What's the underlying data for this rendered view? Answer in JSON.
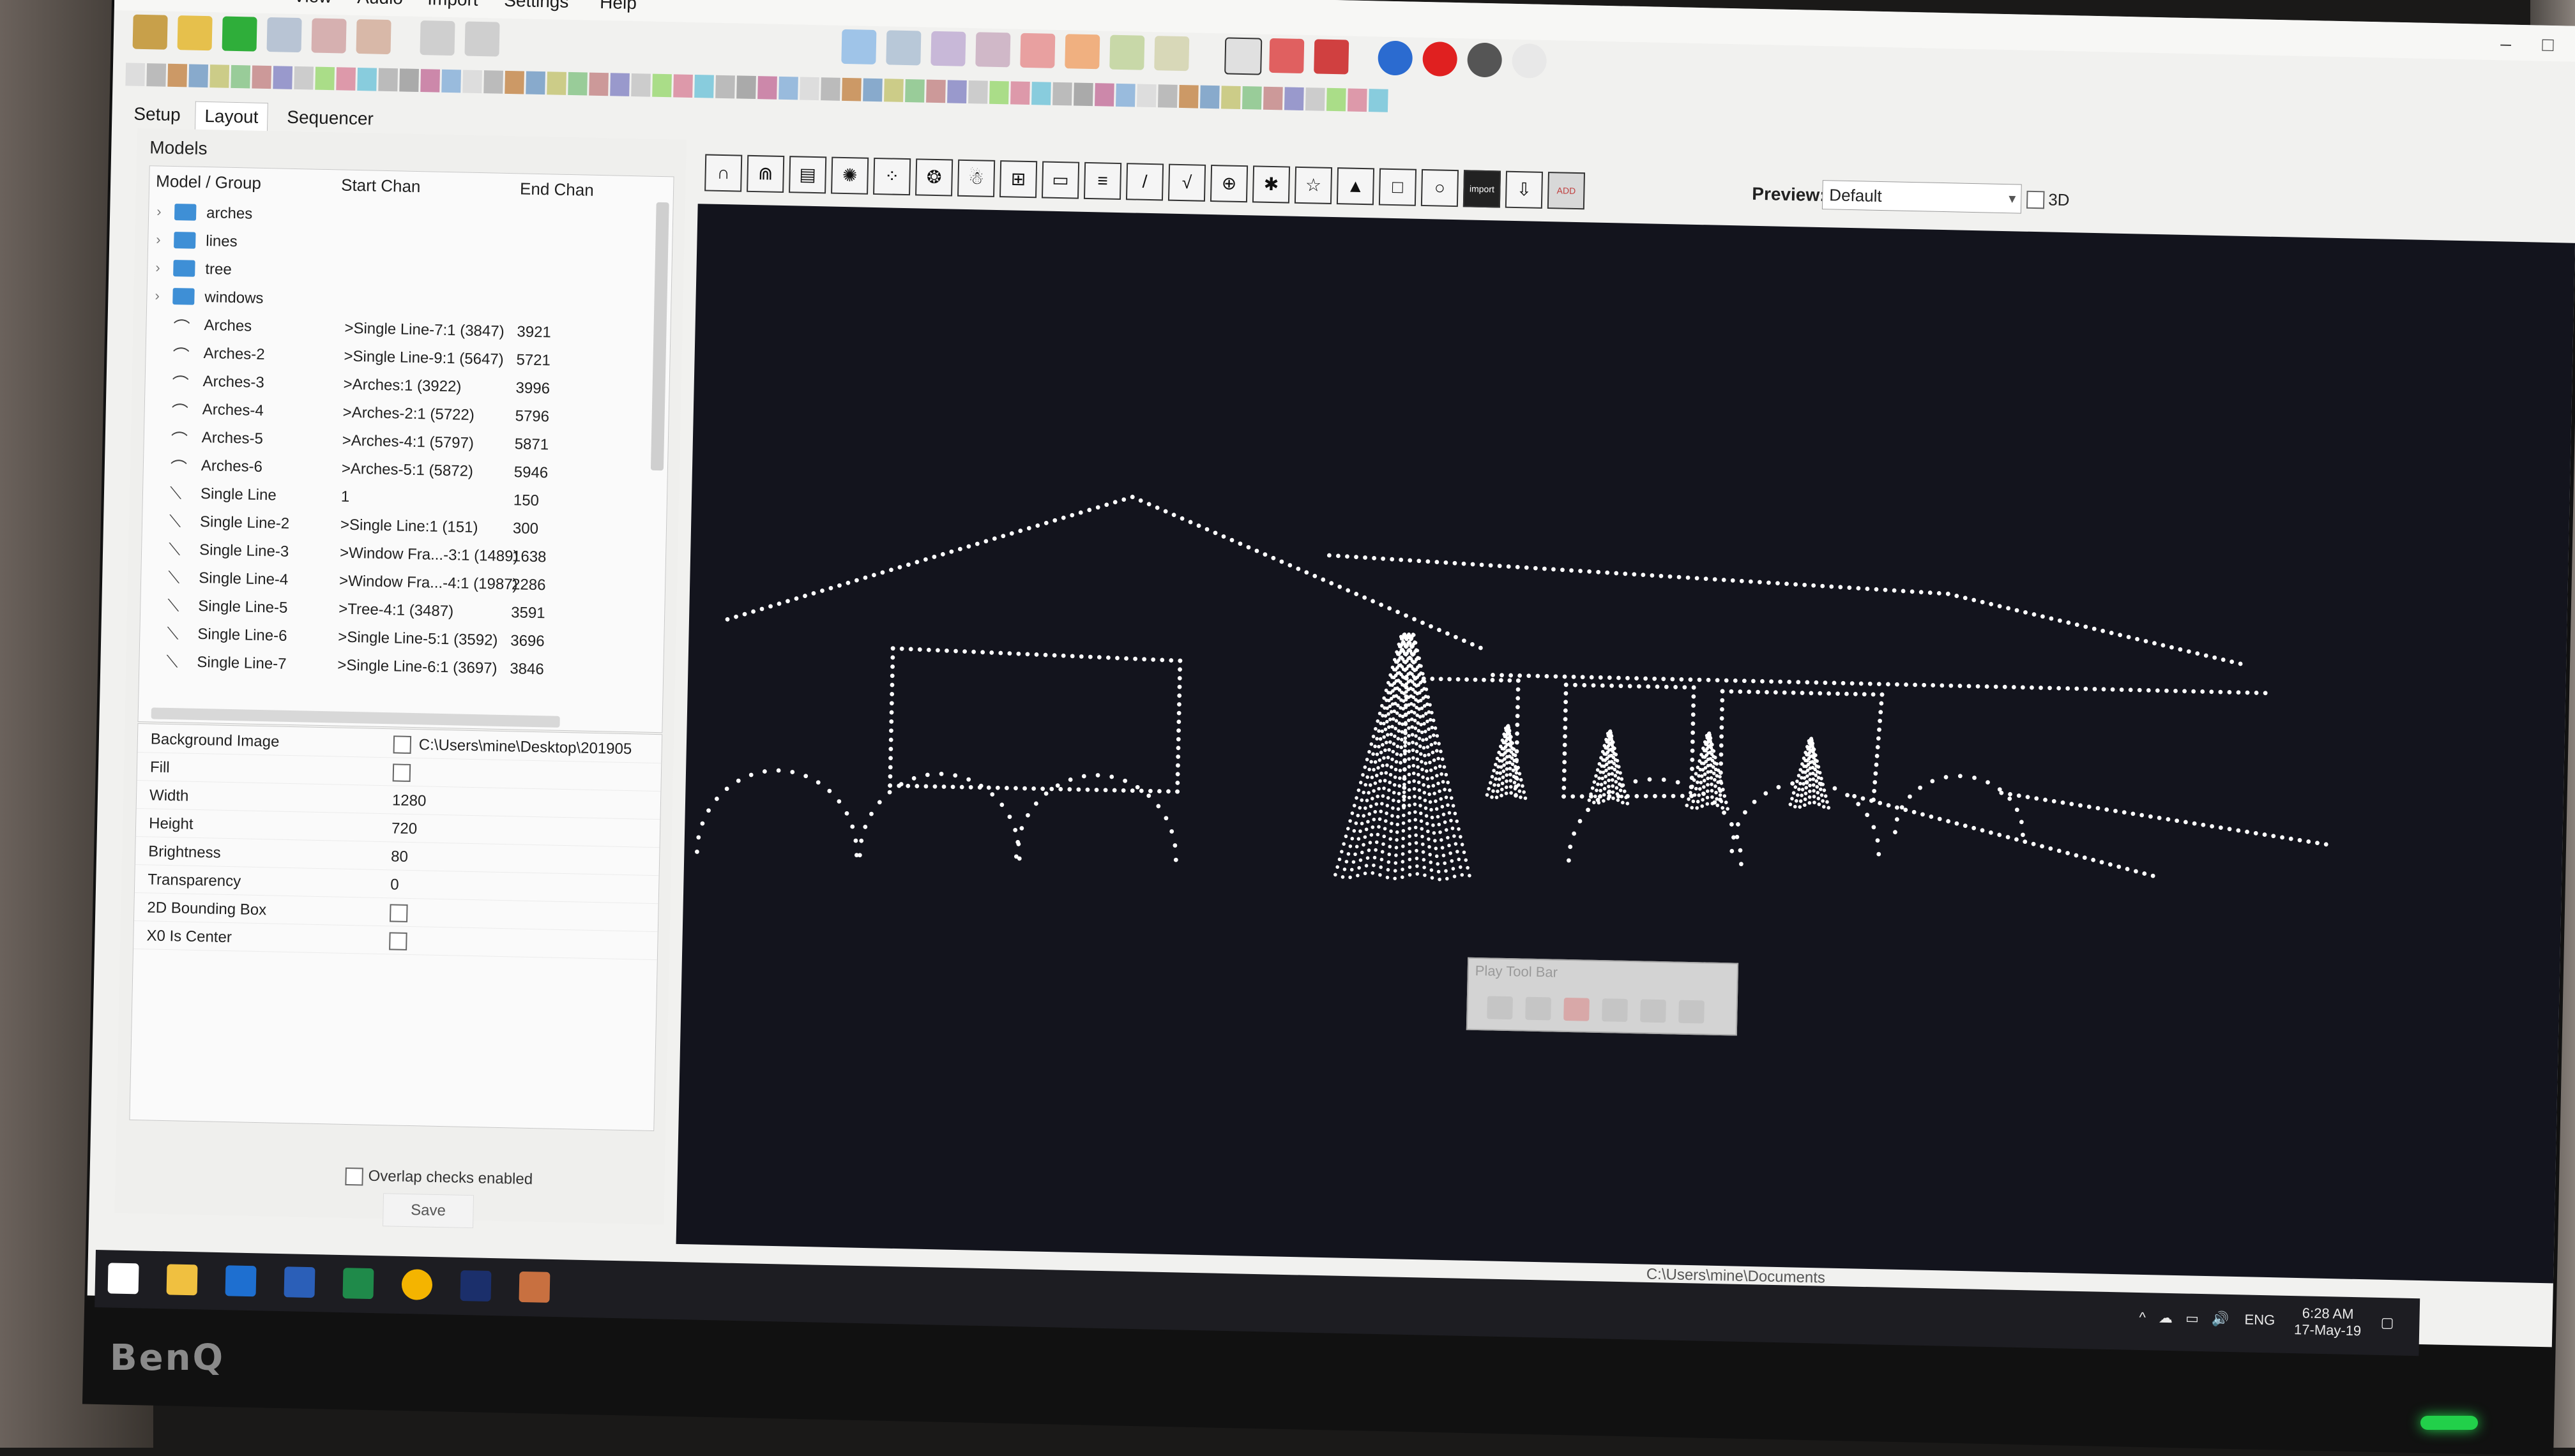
{
  "menubar": {
    "items": [
      "View",
      "Audio",
      "Import",
      "Settings",
      "Help"
    ],
    "window_controls": [
      "–",
      "□"
    ]
  },
  "tabs": [
    "Setup",
    "Layout",
    "Sequencer"
  ],
  "models_panel": {
    "header": "Models",
    "columns": [
      "Model / Group",
      "Start Chan",
      "End Chan"
    ],
    "rows": [
      {
        "type": "group",
        "name": "arches",
        "start": "",
        "end": ""
      },
      {
        "type": "group",
        "name": "lines",
        "start": "",
        "end": ""
      },
      {
        "type": "group",
        "name": "tree",
        "start": "",
        "end": ""
      },
      {
        "type": "group",
        "name": "windows",
        "start": "",
        "end": ""
      },
      {
        "type": "arch",
        "name": "Arches",
        "start": ">Single Line-7:1 (3847)",
        "end": "3921"
      },
      {
        "type": "arch",
        "name": "Arches-2",
        "start": ">Single Line-9:1 (5647)",
        "end": "5721"
      },
      {
        "type": "arch",
        "name": "Arches-3",
        "start": ">Arches:1 (3922)",
        "end": "3996"
      },
      {
        "type": "arch",
        "name": "Arches-4",
        "start": ">Arches-2:1 (5722)",
        "end": "5796"
      },
      {
        "type": "arch",
        "name": "Arches-5",
        "start": ">Arches-4:1 (5797)",
        "end": "5871"
      },
      {
        "type": "arch",
        "name": "Arches-6",
        "start": ">Arches-5:1 (5872)",
        "end": "5946"
      },
      {
        "type": "line",
        "name": "Single Line",
        "start": "1",
        "end": "150"
      },
      {
        "type": "line",
        "name": "Single Line-2",
        "start": ">Single Line:1 (151)",
        "end": "300"
      },
      {
        "type": "line",
        "name": "Single Line-3",
        "start": ">Window Fra...-3:1 (1489)",
        "end": "1638"
      },
      {
        "type": "line",
        "name": "Single Line-4",
        "start": ">Window Fra...-4:1 (1987)",
        "end": "2286"
      },
      {
        "type": "line",
        "name": "Single Line-5",
        "start": ">Tree-4:1 (3487)",
        "end": "3591"
      },
      {
        "type": "line",
        "name": "Single Line-6",
        "start": ">Single Line-5:1 (3592)",
        "end": "3696"
      },
      {
        "type": "line",
        "name": "Single Line-7",
        "start": ">Single Line-6:1 (3697)",
        "end": "3846"
      }
    ]
  },
  "properties": [
    {
      "name": "Background Image",
      "kind": "checkbox-text",
      "value": "C:\\Users\\mine\\Desktop\\201905"
    },
    {
      "name": "Fill",
      "kind": "checkbox",
      "value": ""
    },
    {
      "name": "Width",
      "kind": "text",
      "value": "1280"
    },
    {
      "name": "Height",
      "kind": "text",
      "value": "720"
    },
    {
      "name": "Brightness",
      "kind": "text",
      "value": "80"
    },
    {
      "name": "Transparency",
      "kind": "text",
      "value": "0"
    },
    {
      "name": "2D Bounding Box",
      "kind": "checkbox",
      "value": ""
    },
    {
      "name": "X0 Is Center",
      "kind": "checkbox",
      "value": ""
    }
  ],
  "overlap_checks_label": "Overlap checks enabled",
  "save_label": "Save",
  "model_tools": [
    "∩",
    "⋒",
    "▤",
    "✺",
    "⁘",
    "❂",
    "☃",
    "⊞",
    "▭",
    "≡",
    "/",
    "√",
    "⊕",
    "✱",
    "☆",
    "▲",
    "□",
    "○",
    "import",
    "⇩",
    "ADD OBJ"
  ],
  "preview": {
    "label": "Preview:",
    "value": "Default",
    "three_d_label": "3D"
  },
  "play_toolbar": {
    "title": "Play Tool Bar"
  },
  "status_path": "C:\\Users\\mine\\Documents",
  "taskbar": {
    "icons": [
      "windows-start-icon",
      "file-explorer-icon",
      "outlook-icon",
      "word-icon",
      "excel-icon",
      "chrome-icon",
      "photoshop-icon",
      "xlights-icon"
    ],
    "tray_lang": "ENG",
    "time": "6:28 AM",
    "date": "17-May-19"
  },
  "monitor_brand": "BenQ",
  "colors": {
    "canvas_bg": "#13141d",
    "light_dots": "#ffffff",
    "folder_blue": "#3e8fd6",
    "record_red": "#e02020"
  }
}
